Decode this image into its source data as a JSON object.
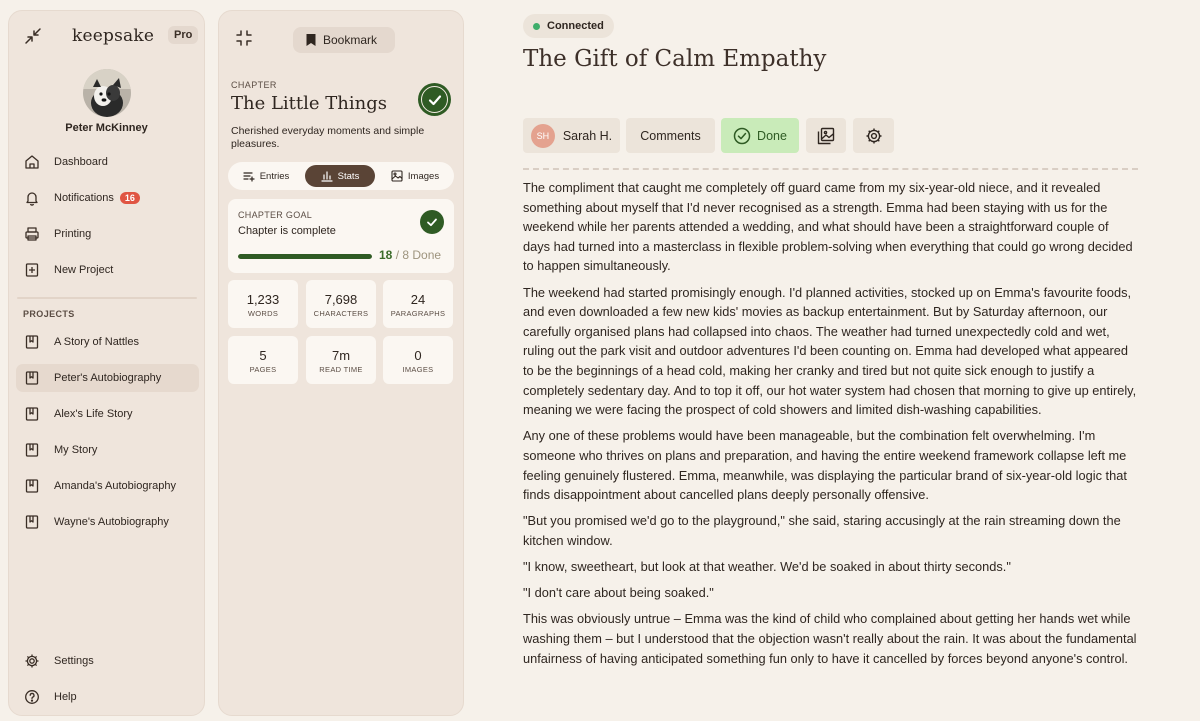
{
  "sidebar": {
    "logo": "keepsake",
    "plan_badge": "Pro",
    "user_name": "Peter McKinney",
    "nav": [
      {
        "label": "Dashboard",
        "icon": "home-icon"
      },
      {
        "label": "Notifications",
        "icon": "bell-icon",
        "count": "16"
      },
      {
        "label": "Printing",
        "icon": "printer-icon"
      },
      {
        "label": "New Project",
        "icon": "new-project-icon"
      }
    ],
    "projects_heading": "PROJECTS",
    "projects": [
      {
        "label": "A Story of Nattles",
        "active": false
      },
      {
        "label": "Peter's Autobiography",
        "active": true
      },
      {
        "label": "Alex's Life Story",
        "active": false
      },
      {
        "label": "My Story",
        "active": false
      },
      {
        "label": "Amanda's Autobiography",
        "active": false
      },
      {
        "label": "Wayne's Autobiography",
        "active": false
      }
    ],
    "bottom": [
      {
        "label": "Settings",
        "icon": "gear-icon"
      },
      {
        "label": "Help",
        "icon": "help-icon"
      }
    ]
  },
  "chapter_panel": {
    "bookmark_label": "Bookmark",
    "chapter_label": "CHAPTER",
    "chapter_title": "The Little Things",
    "chapter_description": "Cherished everyday moments and simple pleasures.",
    "tabs": [
      {
        "label": "Entries",
        "active": false
      },
      {
        "label": "Stats",
        "active": true
      },
      {
        "label": "Images",
        "active": false
      }
    ],
    "goal": {
      "label": "CHAPTER GOAL",
      "status": "Chapter is complete",
      "done": "18",
      "total_text": "/ 8 Done",
      "progress_fraction": 1.0
    },
    "stats": [
      {
        "value": "1,233",
        "caption": "WORDS"
      },
      {
        "value": "7,698",
        "caption": "CHARACTERS"
      },
      {
        "value": "24",
        "caption": "PARAGRAPHS"
      },
      {
        "value": "5",
        "caption": "PAGES"
      },
      {
        "value": "7m",
        "caption": "READ TIME"
      },
      {
        "value": "0",
        "caption": "IMAGES"
      }
    ]
  },
  "main": {
    "connection_status": "Connected",
    "title": "The Gift of Calm Empathy",
    "toolbar": {
      "author_initials": "SH",
      "author_name": "Sarah H.",
      "comments_label": "Comments",
      "done_label": "Done"
    },
    "paragraphs": [
      "The compliment that caught me completely off guard came from my six-year-old niece, and it revealed something about myself that I'd never recognised as a strength. Emma had been staying with us for the weekend while her parents attended a wedding, and what should have been a straightforward couple of days had turned into a masterclass in flexible problem-solving when everything that could go wrong decided to happen simultaneously.",
      "The weekend had started promisingly enough. I'd planned activities, stocked up on Emma's favourite foods, and even downloaded a few new kids' movies as backup entertainment. But by Saturday afternoon, our carefully organised plans had collapsed into chaos. The weather had turned unexpectedly cold and wet, ruling out the park visit and outdoor adventures I'd been counting on. Emma had developed what appeared to be the beginnings of a head cold, making her cranky and tired but not quite sick enough to justify a completely sedentary day. And to top it off, our hot water system had chosen that morning to give up entirely, meaning we were facing the prospect of cold showers and limited dish-washing capabilities.",
      "Any one of these problems would have been manageable, but the combination felt overwhelming. I'm someone who thrives on plans and preparation, and having the entire weekend framework collapse left me feeling genuinely flustered. Emma, meanwhile, was displaying the particular brand of six-year-old logic that finds disappointment about cancelled plans deeply personally offensive.",
      "\"But you promised we'd go to the playground,\" she said, staring accusingly at the rain streaming down the kitchen window.",
      "\"I know, sweetheart, but look at that weather. We'd be soaked in about thirty seconds.\"",
      "\"I don't care about being soaked.\"",
      "This was obviously untrue – Emma was the kind of child who complained about getting her hands wet while washing them – but I understood that the objection wasn't really about the rain. It was about the fundamental unfairness of having anticipated something fun only to have it cancelled by forces beyond anyone's control."
    ]
  }
}
